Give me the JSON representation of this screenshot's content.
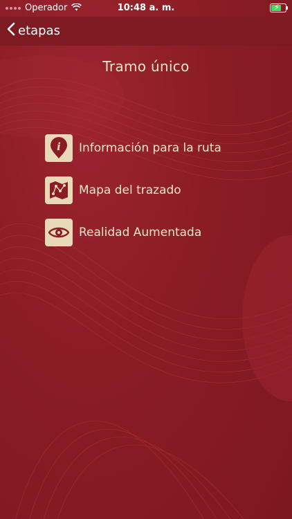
{
  "status_bar": {
    "carrier": "Operador",
    "time": "10:48 a. m."
  },
  "nav": {
    "back_label": "etapas"
  },
  "page": {
    "title": "Tramo único"
  },
  "menu": [
    {
      "label": "Información para la ruta",
      "icon": "info-pin-icon"
    },
    {
      "label": "Mapa del trazado",
      "icon": "map-route-icon"
    },
    {
      "label": "Realidad Aumentada",
      "icon": "eye-icon"
    }
  ],
  "colors": {
    "background": "#8a1c24",
    "nav_bar": "#7e1a22",
    "icon_tile": "#ead9b6",
    "icon_glyph": "#8a1c24",
    "text": "#f2e6c8"
  }
}
